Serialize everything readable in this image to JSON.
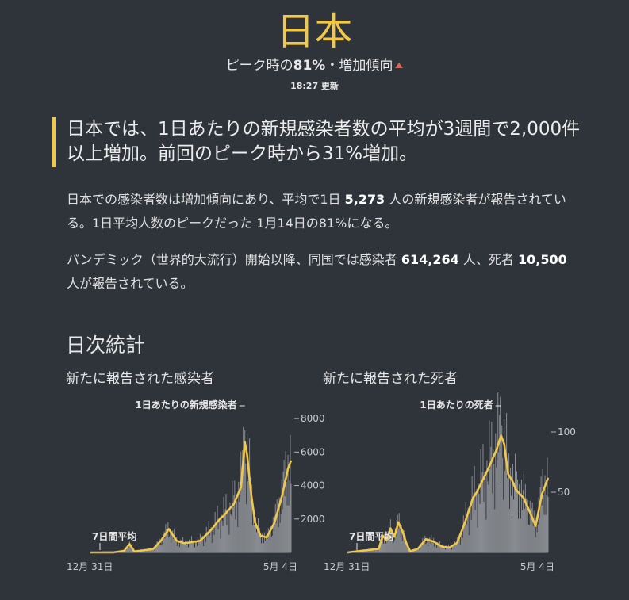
{
  "header": {
    "country": "日本",
    "subtitle_prefix": "ピーク時の",
    "subtitle_percent": "81%",
    "subtitle_suffix": "・増加傾向",
    "updated": "18:27 更新"
  },
  "headline": "日本では、1日あたりの新規感染者数の平均が3週間で2,000件以上増加。前回のピーク時から31%増加。",
  "para1": {
    "a": "日本での感染者数は増加傾向にあり、平均で1日",
    "b": "5,273",
    "c": "人の新規感染者が報告されている。1日平均人数のピークだった 1月14日の81%になる。"
  },
  "para2": {
    "a": "パンデミック（世界的大流行）開始以降、同国では感染者",
    "b": "614,264",
    "c": "人、死者",
    "d": "10,500",
    "e": "人が報告されている。"
  },
  "section_title": "日次統計",
  "colors": {
    "accent": "#f2c84b",
    "bars": "#8a8d92",
    "background": "#2f343b",
    "up_arrow": "#e8604c"
  },
  "chart_data": [
    {
      "type": "area",
      "title": "新たに報告された感染者",
      "series_label": "1日あたりの新規感染者",
      "avg_label": "7日間平均",
      "x_start": "12月 31日",
      "x_end": "5月 4日",
      "ylim": [
        0,
        9000
      ],
      "yticks": [
        2000,
        4000,
        6000,
        8000
      ],
      "ytick_labels": [
        "2000",
        "4000",
        "6000",
        "8000"
      ],
      "avg_keypoints": [
        {
          "d": 0,
          "v": 0
        },
        {
          "d": 30,
          "v": 5
        },
        {
          "d": 43,
          "v": 100
        },
        {
          "d": 50,
          "v": 500
        },
        {
          "d": 56,
          "v": 60
        },
        {
          "d": 80,
          "v": 200
        },
        {
          "d": 90,
          "v": 700
        },
        {
          "d": 100,
          "v": 1400
        },
        {
          "d": 110,
          "v": 700
        },
        {
          "d": 120,
          "v": 550
        },
        {
          "d": 140,
          "v": 700
        },
        {
          "d": 155,
          "v": 1400
        },
        {
          "d": 165,
          "v": 2000
        },
        {
          "d": 170,
          "v": 2200
        },
        {
          "d": 183,
          "v": 2900
        },
        {
          "d": 192,
          "v": 3900
        },
        {
          "d": 197,
          "v": 6600
        },
        {
          "d": 200,
          "v": 5800
        },
        {
          "d": 205,
          "v": 3500
        },
        {
          "d": 210,
          "v": 1800
        },
        {
          "d": 217,
          "v": 1000
        },
        {
          "d": 225,
          "v": 900
        },
        {
          "d": 235,
          "v": 1800
        },
        {
          "d": 245,
          "v": 3500
        },
        {
          "d": 252,
          "v": 5000
        },
        {
          "d": 256,
          "v": 5500
        }
      ]
    },
    {
      "type": "area",
      "title": "新たに報告された死者",
      "series_label": "1日あたりの死者",
      "avg_label": "7日間平均",
      "x_start": "12月 31日",
      "x_end": "5月 4日",
      "ylim": [
        0,
        125
      ],
      "yticks": [
        50,
        100
      ],
      "ytick_labels": [
        "50",
        "100"
      ],
      "avg_keypoints": [
        {
          "d": 0,
          "v": 0
        },
        {
          "d": 40,
          "v": 3
        },
        {
          "d": 45,
          "v": 14
        },
        {
          "d": 50,
          "v": 10
        },
        {
          "d": 55,
          "v": 20
        },
        {
          "d": 60,
          "v": 13
        },
        {
          "d": 65,
          "v": 25
        },
        {
          "d": 70,
          "v": 18
        },
        {
          "d": 75,
          "v": 8
        },
        {
          "d": 80,
          "v": 1
        },
        {
          "d": 90,
          "v": 3
        },
        {
          "d": 100,
          "v": 11
        },
        {
          "d": 110,
          "v": 9
        },
        {
          "d": 120,
          "v": 5
        },
        {
          "d": 130,
          "v": 4
        },
        {
          "d": 140,
          "v": 8
        },
        {
          "d": 150,
          "v": 25
        },
        {
          "d": 160,
          "v": 45
        },
        {
          "d": 165,
          "v": 50
        },
        {
          "d": 180,
          "v": 70
        },
        {
          "d": 190,
          "v": 85
        },
        {
          "d": 196,
          "v": 97
        },
        {
          "d": 200,
          "v": 90
        },
        {
          "d": 205,
          "v": 65
        },
        {
          "d": 210,
          "v": 60
        },
        {
          "d": 215,
          "v": 52
        },
        {
          "d": 225,
          "v": 45
        },
        {
          "d": 235,
          "v": 30
        },
        {
          "d": 240,
          "v": 22
        },
        {
          "d": 248,
          "v": 48
        },
        {
          "d": 256,
          "v": 62
        }
      ]
    }
  ]
}
